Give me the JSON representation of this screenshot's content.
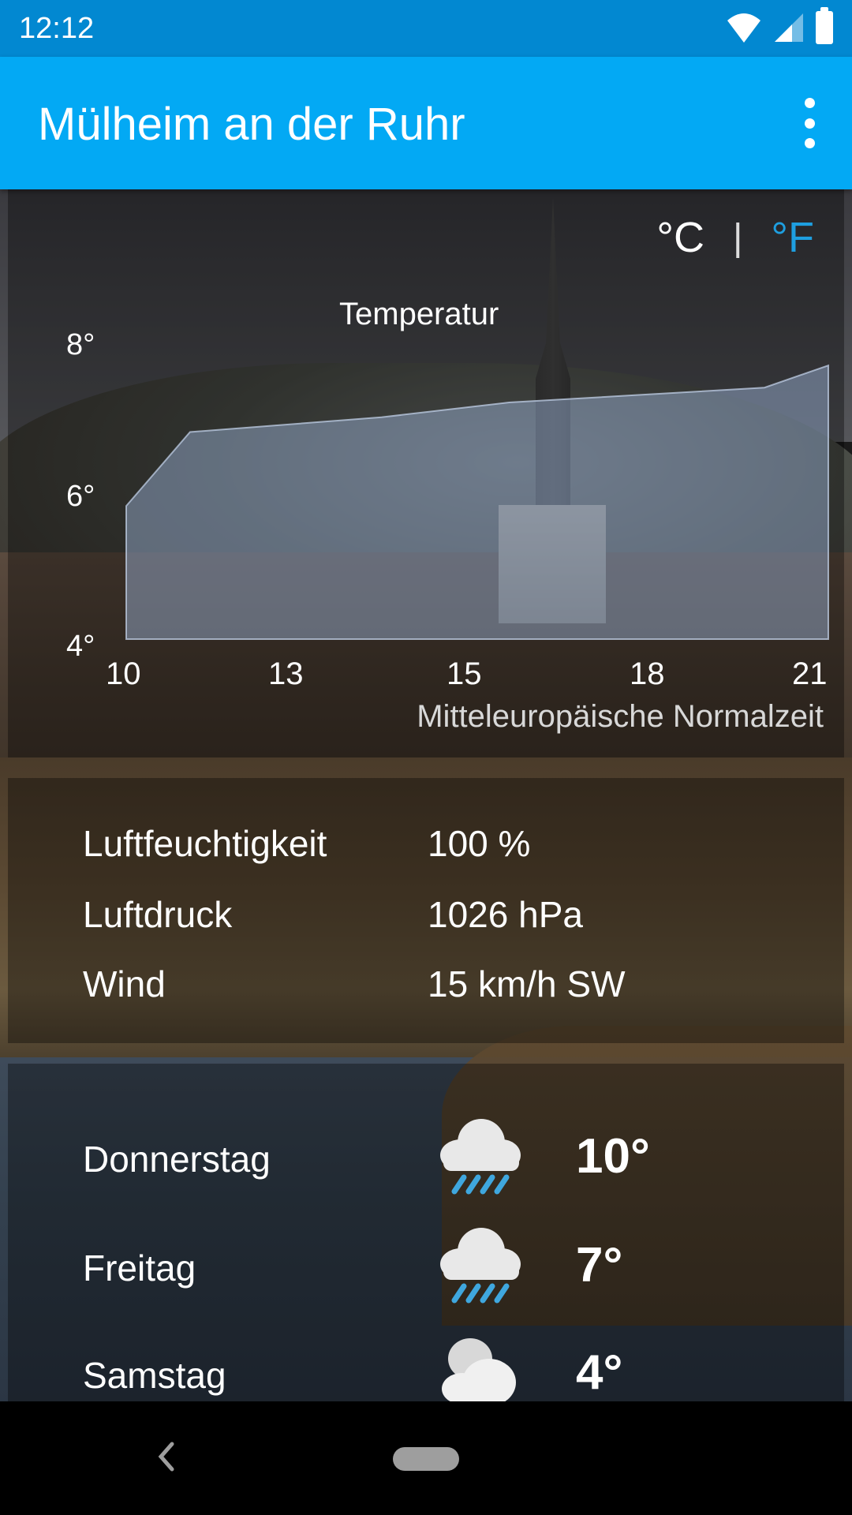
{
  "status_bar": {
    "time": "12:12"
  },
  "app_bar": {
    "title": "Mülheim an der Ruhr"
  },
  "units": {
    "celsius": "°C",
    "separator": "|",
    "fahrenheit": "°F",
    "selected": "celsius"
  },
  "colors": {
    "status_bar": "#0288d1",
    "app_bar": "#03a9f4",
    "unit_inactive": "#1e9fe0"
  },
  "chart_data": {
    "type": "area",
    "title": "Temperatur",
    "x_ticks": [
      "10",
      "13",
      "15",
      "18",
      "21"
    ],
    "y_ticks": [
      "8°",
      "6°",
      "4°"
    ],
    "ylim": [
      4,
      8
    ],
    "x": [
      9,
      11,
      14,
      16,
      18,
      20,
      22
    ],
    "y": [
      5.8,
      6.8,
      7.0,
      7.2,
      7.3,
      7.4,
      7.7
    ],
    "footnote": "Mitteleuropäische Normalzeit"
  },
  "details": {
    "humidity_label": "Luftfeuchtigkeit",
    "humidity_value": "100 %",
    "pressure_label": "Luftdruck",
    "pressure_value": "1026 hPa",
    "wind_label": "Wind",
    "wind_value": "15 km/h SW"
  },
  "forecast": [
    {
      "day": "Donnerstag",
      "temp": "10°",
      "icon": "rain-cloud-icon"
    },
    {
      "day": "Freitag",
      "temp": "7°",
      "icon": "rain-cloud-icon"
    },
    {
      "day": "Samstag",
      "temp": "4°",
      "icon": "cloud-icon"
    }
  ]
}
